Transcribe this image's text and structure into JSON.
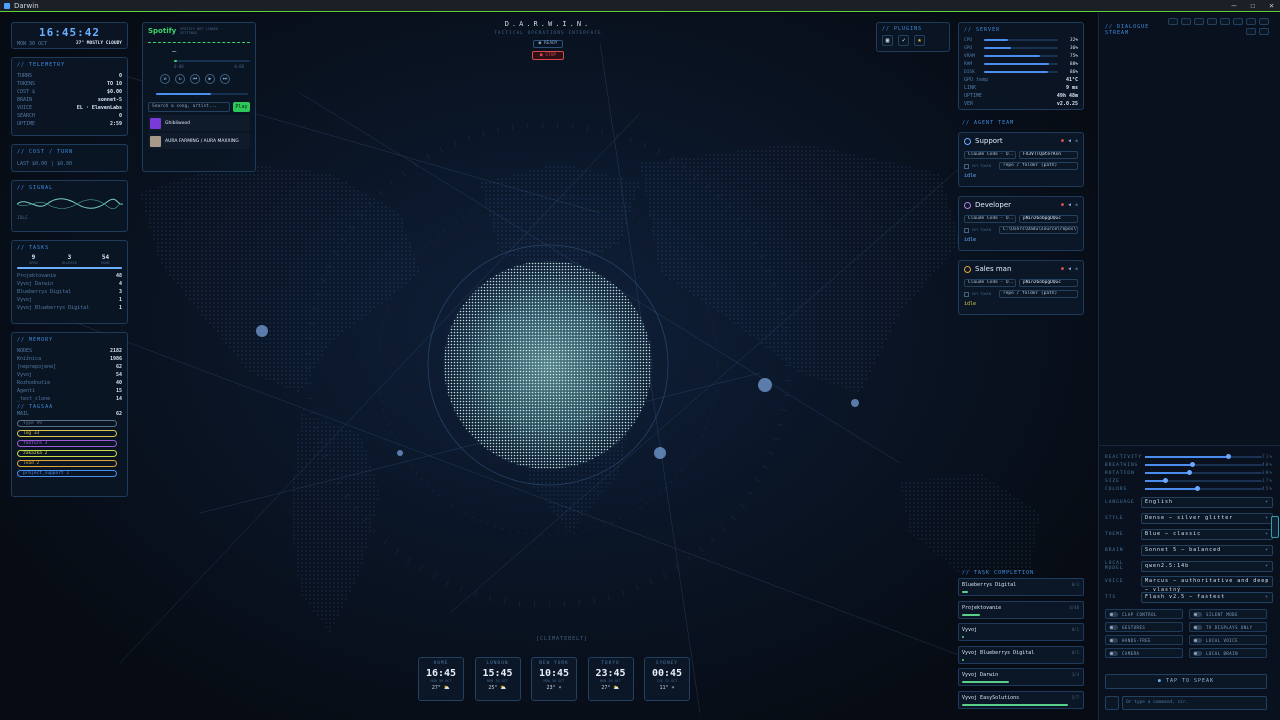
{
  "window": {
    "title": "Darwin",
    "minimize": "–",
    "maximize": "☐",
    "close": "✕"
  },
  "header": {
    "title": "D.A.R.W.I.N.",
    "subtitle": "TACTICAL OPERATIONS INTERFACE",
    "status": "READY",
    "stop": "STOP"
  },
  "clock": {
    "time": "16:45:42",
    "date": "MON 30 OCT",
    "weather": "27° MOSTLY CLOUDY"
  },
  "telemetry": {
    "title": "// TELEMETRY",
    "rows": [
      {
        "k": "TURNS",
        "v": "0"
      },
      {
        "k": "TOKENS",
        "v": "TO 10"
      },
      {
        "k": "COST $",
        "v": "$0.00"
      },
      {
        "k": "BRAIN",
        "v": "sonnet-5"
      },
      {
        "k": "VOICE",
        "v": "EL · ElevenLabs"
      },
      {
        "k": "SEARCH",
        "v": "0"
      },
      {
        "k": "UPTIME",
        "v": "2:59"
      }
    ]
  },
  "cost": {
    "title": "// COST / TURN",
    "last": "LAST $0.00",
    "avg": "| $0.00"
  },
  "signal": {
    "title": "// SIGNAL",
    "state": "IDLE"
  },
  "tasks": {
    "title": "// TASKS",
    "counts": [
      {
        "n": "9",
        "l": "OPEN"
      },
      {
        "n": "3",
        "l": "BLOCKED"
      },
      {
        "n": "54",
        "l": "DONE"
      }
    ],
    "items": [
      {
        "k": "Projektovanie",
        "v": "48"
      },
      {
        "k": "Vyvoj Darwin",
        "v": "4"
      },
      {
        "k": "Blueberrys Digital",
        "v": "3"
      },
      {
        "k": "Vyvoj",
        "v": "1"
      },
      {
        "k": "Vyvoj Blueberrys Digital",
        "v": "1"
      }
    ]
  },
  "memory": {
    "title": "// MEMORY",
    "items": [
      {
        "k": "NODES",
        "v": "2182"
      },
      {
        "k": "Knižnica",
        "v": "1986"
      },
      {
        "k": "[neprepojene]",
        "v": "62"
      },
      {
        "k": "Vyvoj",
        "v": "54"
      },
      {
        "k": "Rozhodnutie",
        "v": "40"
      },
      {
        "k": "Agenti",
        "v": "15"
      },
      {
        "k": "_test_clone",
        "v": "14"
      }
    ],
    "tags_title": "// TAGSAA",
    "mail": {
      "k": "MAIL",
      "v": "62"
    },
    "tags": [
      {
        "label": "type 99",
        "color": "#5a6f88"
      },
      {
        "label": "log 33",
        "color": "#d9c64a"
      },
      {
        "label": "feature 3",
        "color": "#a05ad9"
      },
      {
        "label": "zakazka 2",
        "color": "#c9d94a"
      },
      {
        "label": "lead 2",
        "color": "#e0a43a"
      },
      {
        "label": "project_support 1",
        "color": "#4a8ff0"
      }
    ]
  },
  "spotify": {
    "brand": "Spotify",
    "status": "SPOTIFY NOT LINKED · SETTINGS",
    "track": "—",
    "time_start": "0:00",
    "time_end": "0:00",
    "search_placeholder": "Search a song, artist...",
    "play": "Play",
    "results": [
      {
        "title": "Ghibliwood"
      },
      {
        "title": "AURA FARMING / AURA MAXXING"
      }
    ]
  },
  "plugins": {
    "title": "// PLUGINS",
    "icons": [
      "cube-icon",
      "rocket-icon",
      "star-icon"
    ]
  },
  "server": {
    "title": "// SERVER",
    "bars": [
      {
        "k": "CPU",
        "v": "32%",
        "f": 0.32
      },
      {
        "k": "GPU",
        "v": "36%",
        "f": 0.36
      },
      {
        "k": "VRAM",
        "v": "75%",
        "f": 0.75
      },
      {
        "k": "RAM",
        "v": "88%",
        "f": 0.88
      },
      {
        "k": "DISK",
        "v": "86%",
        "f": 0.86
      }
    ],
    "rows": [
      {
        "k": "GPU temp",
        "v": "41°C"
      },
      {
        "k": "LINK",
        "v": "9 ms"
      },
      {
        "k": "UPTIME",
        "v": "49h 48m"
      },
      {
        "k": "VER",
        "v": "v2.0.25"
      }
    ]
  },
  "agents": {
    "title": "// AGENT TEAM",
    "items": [
      {
        "name": "Support",
        "model": "Claude Code · O..",
        "key": "FX3VTTQaterAsn",
        "path": "repo / folder (path)",
        "state": "idle"
      },
      {
        "name": "Developer",
        "model": "Claude Code · O..",
        "key": "pNInz6obpgDQGc",
        "path": "C:\\Users\\Dadu\\source\\repos\\te",
        "state": "idle"
      },
      {
        "name": "Sales man",
        "model": "Claude Code · O..",
        "key": "pNInz6obpgDQGc",
        "path": "repo / folder (path)",
        "state": "idle"
      }
    ],
    "key_label": "KEY TOKEN"
  },
  "task_completion": {
    "title": "// TASK COMPLETION",
    "items": [
      {
        "name": "Blueberrys Digital",
        "pct": "0/3",
        "f": 0.05
      },
      {
        "name": "Projektovanie",
        "pct": "4/48",
        "f": 0.15
      },
      {
        "name": "Vyvoj",
        "pct": "0/1",
        "f": 0.02
      },
      {
        "name": "Vyvoj Blueberrys Digital",
        "pct": "0/1",
        "f": 0.02
      },
      {
        "name": "Vyvoj Darwin",
        "pct": "3/4",
        "f": 0.4
      },
      {
        "name": "Vyvoj EasySolutions",
        "pct": "5/7",
        "f": 0.9
      }
    ]
  },
  "clocks": [
    {
      "city": "HOME",
      "time": "16:45",
      "day": "MON 30 OCT",
      "wx": "27° ⛅"
    },
    {
      "city": "LONDON",
      "time": "15:45",
      "day": "MON 30 OCT",
      "wx": "25° ⛅"
    },
    {
      "city": "NEW YORK",
      "time": "10:45",
      "day": "MON 30 OCT",
      "wx": "23° ☀"
    },
    {
      "city": "TOKYO",
      "time": "23:45",
      "day": "MON 30 OCT",
      "wx": "27° ⛅"
    },
    {
      "city": "SYDNEY",
      "time": "00:45",
      "day": "TUE 31 OCT",
      "wx": "11° ☀"
    }
  ],
  "map_caption": "[CLIMATEBELT]",
  "dialogue": {
    "title": "// DIALOGUE STREAM"
  },
  "controls": {
    "sliders": [
      {
        "k": "REACTIVITY",
        "v": "71%",
        "f": 0.71
      },
      {
        "k": "BREATHING",
        "v": "40%",
        "f": 0.4
      },
      {
        "k": "ROTATION",
        "v": "38%",
        "f": 0.38
      },
      {
        "k": "SIZE",
        "v": "17%",
        "f": 0.17
      },
      {
        "k": "COLORS",
        "v": "45%",
        "f": 0.45
      }
    ],
    "settings": [
      {
        "k": "LANGUAGE",
        "v": "English"
      },
      {
        "k": "STYLE",
        "v": "Dense — silver glitter"
      },
      {
        "k": "THEME",
        "v": "Blue — classic"
      },
      {
        "k": "BRAIN",
        "v": "Sonnet 5 — balanced"
      },
      {
        "k": "LOCAL MODEL",
        "v": "qwen2.5:14b"
      },
      {
        "k": "VOICE",
        "v": "Marcus — authoritative and deep — vlastný"
      },
      {
        "k": "TTS",
        "v": "Flash v2.5 — fastest"
      }
    ],
    "toggles": [
      "CLAP CONTROL",
      "SILENT MODE",
      "GESTURES",
      "TV DISPLAYS ONLY",
      "HANDS-FREE",
      "LOCAL VOICE",
      "CAMERA",
      "LOCAL BRAIN"
    ],
    "speak": "TAP TO SPEAK",
    "command_placeholder": "Or type a command, sir."
  }
}
